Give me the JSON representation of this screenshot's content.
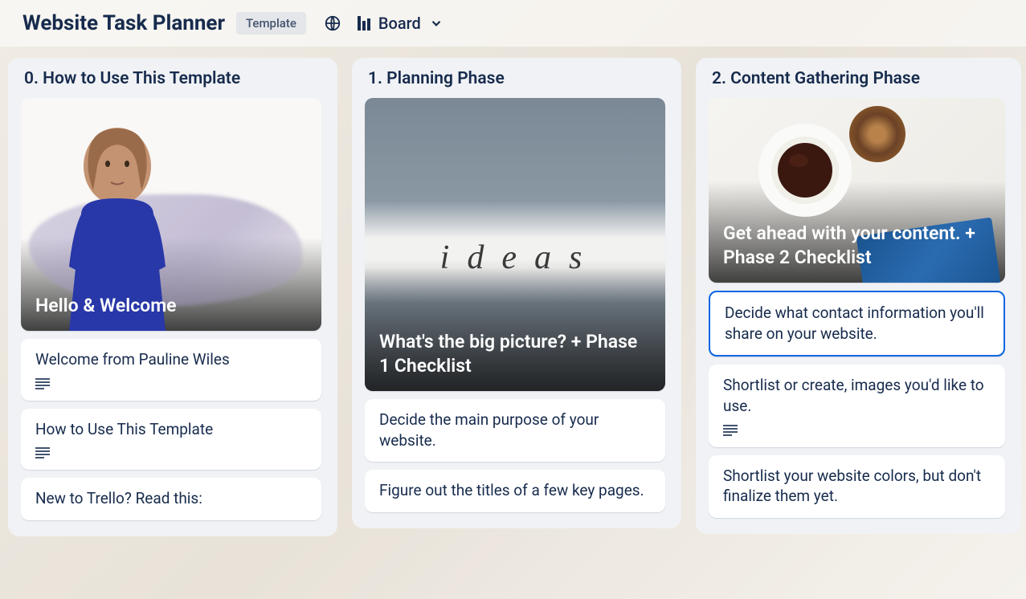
{
  "header": {
    "title": "Website Task Planner",
    "template_label": "Template",
    "view_label": "Board"
  },
  "lists": [
    {
      "title": "0. How to Use This Template",
      "cards": [
        {
          "cover": true,
          "cover_kind": "person",
          "title": "Hello & Welcome"
        },
        {
          "title": "Welcome from Pauline Wiles",
          "has_description": true
        },
        {
          "title": "How to Use This Template",
          "has_description": true
        },
        {
          "title": "New to Trello? Read this:"
        }
      ]
    },
    {
      "title": "1. Planning Phase",
      "cards": [
        {
          "cover": true,
          "cover_kind": "ideas",
          "title": "What's the big picture? + Phase 1 Checklist"
        },
        {
          "title": "Decide the main purpose of your website."
        },
        {
          "title": "Figure out the titles of a few key pages."
        }
      ]
    },
    {
      "title": "2. Content Gathering Phase",
      "cards": [
        {
          "cover": true,
          "cover_kind": "coffee",
          "title": "Get ahead with your content. + Phase 2 Checklist"
        },
        {
          "title": "Decide what contact information you'll share on your website.",
          "selected": true
        },
        {
          "title": "Shortlist or create, images you'd like to use.",
          "has_description": true
        },
        {
          "title": "Shortlist your website colors, but don't finalize them yet."
        }
      ]
    }
  ],
  "ideas_word": "ideas"
}
